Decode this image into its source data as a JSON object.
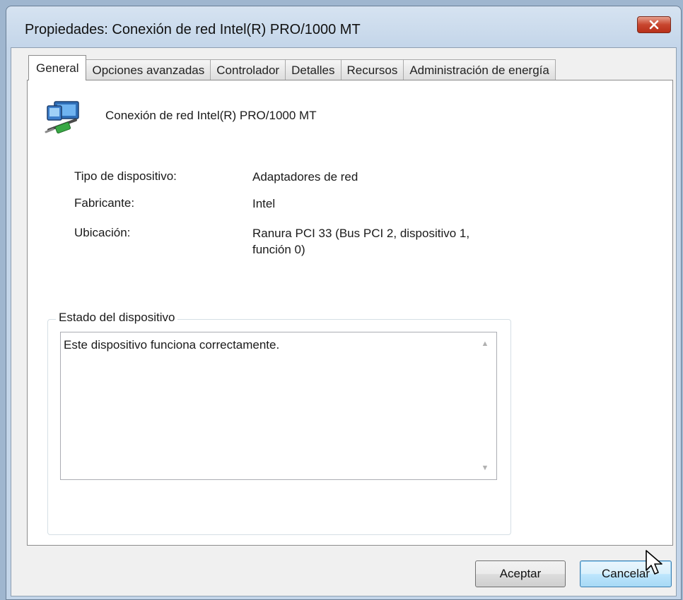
{
  "window": {
    "title": "Propiedades: Conexión de red Intel(R) PRO/1000 MT"
  },
  "tabs": [
    {
      "label": "General",
      "active": true
    },
    {
      "label": "Opciones avanzadas"
    },
    {
      "label": "Controlador"
    },
    {
      "label": "Detalles"
    },
    {
      "label": "Recursos"
    },
    {
      "label": "Administración de energía"
    }
  ],
  "device": {
    "name": "Conexión de red Intel(R) PRO/1000 MT",
    "icon": "network-adapter-icon"
  },
  "properties": [
    {
      "label": "Tipo de dispositivo:",
      "value": "Adaptadores de red"
    },
    {
      "label": "Fabricante:",
      "value": "Intel"
    },
    {
      "label": "Ubicación:",
      "value_line1": "Ranura PCI 33 (Bus PCI 2, dispositivo 1,",
      "value_line2": "función 0)"
    }
  ],
  "status_group": {
    "title": "Estado del dispositivo",
    "text": "Este dispositivo funciona correctamente."
  },
  "buttons": {
    "ok": "Aceptar",
    "cancel": "Cancelar"
  },
  "colors": {
    "close_button": "#c8452e",
    "focused_button_border": "#3c7fb1"
  }
}
